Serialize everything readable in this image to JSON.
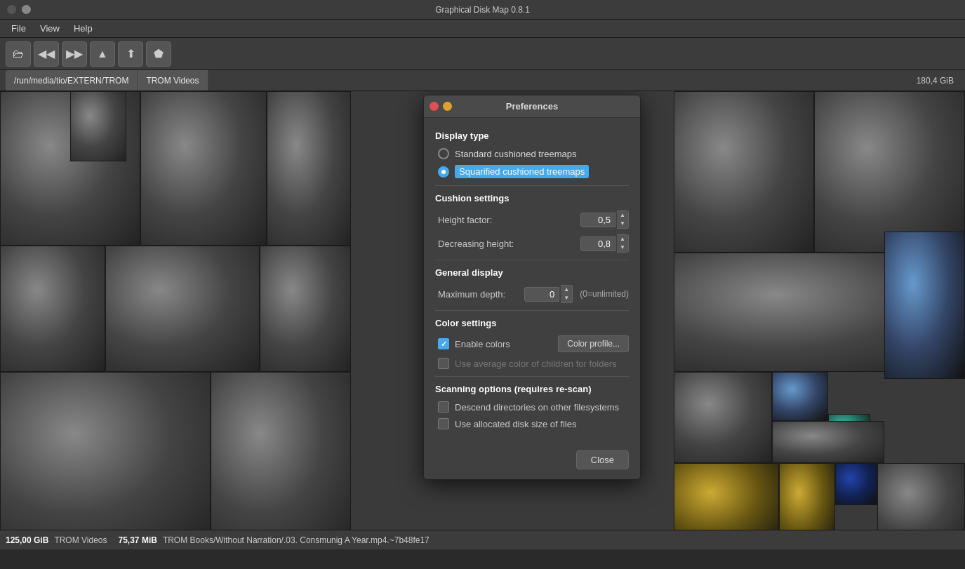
{
  "titlebar": {
    "title": "Graphical Disk Map 0.8.1",
    "close_btn": "●",
    "minimize_btn": "●"
  },
  "menubar": {
    "items": [
      "File",
      "View",
      "Help"
    ]
  },
  "toolbar": {
    "buttons": [
      {
        "name": "open-folder",
        "icon": "🗁"
      },
      {
        "name": "back",
        "icon": "◀◀"
      },
      {
        "name": "forward",
        "icon": "▶▶"
      },
      {
        "name": "up",
        "icon": "▲"
      },
      {
        "name": "up-top",
        "icon": "⬆"
      },
      {
        "name": "home",
        "icon": "⬟"
      }
    ]
  },
  "breadcrumb": {
    "path": "/run/media/tio/EXTERN/TROM",
    "current": "TROM Videos",
    "size": "180,4 GiB"
  },
  "preferences": {
    "title": "Preferences",
    "display_type": {
      "label": "Display type",
      "options": [
        {
          "id": "standard",
          "label": "Standard cushioned treemaps",
          "selected": false
        },
        {
          "id": "squarified",
          "label": "Squarified cushioned treemaps",
          "selected": true
        }
      ]
    },
    "cushion_settings": {
      "label": "Cushion settings",
      "height_factor": {
        "label": "Height factor:",
        "value": "0,5"
      },
      "decreasing_height": {
        "label": "Decreasing height:",
        "value": "0,8"
      }
    },
    "general_display": {
      "label": "General display",
      "max_depth": {
        "label": "Maximum depth:",
        "value": "0",
        "hint": "(0=unlimited)"
      }
    },
    "color_settings": {
      "label": "Color settings",
      "enable_colors": {
        "label": "Enable colors",
        "checked": true
      },
      "color_profile_btn": "Color profile...",
      "avg_color": {
        "label": "Use average color of children for folders",
        "checked": false,
        "disabled": true
      }
    },
    "scanning_options": {
      "label": "Scanning options (requires re-scan)",
      "descend_dirs": {
        "label": "Descend directories on other filesystems",
        "checked": false
      },
      "allocated_size": {
        "label": "Use allocated disk size of files",
        "checked": false
      }
    },
    "close_btn": "Close"
  },
  "statusbar": {
    "items": [
      {
        "size": "125,00 GiB",
        "label": "TROM Videos"
      },
      {
        "size": "75,37 MiB",
        "label": "TROM Books/Without Narration/.03. Consmunig A Year.mp4.~7b48fe17"
      }
    ]
  }
}
